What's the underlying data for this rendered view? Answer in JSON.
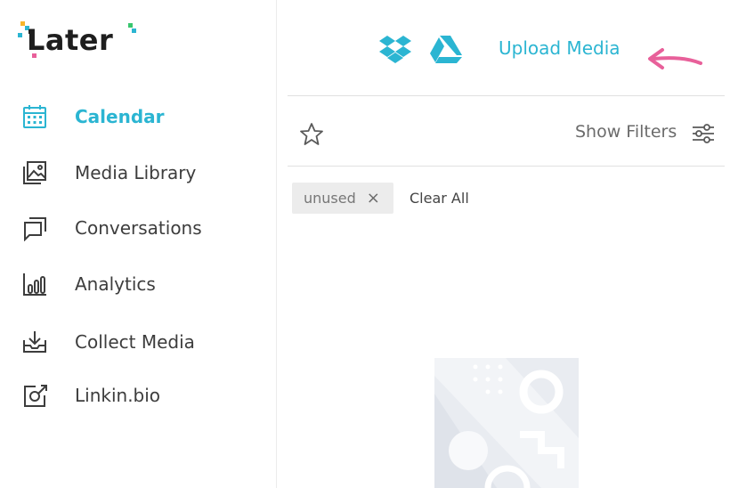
{
  "brand": {
    "logo_text": "Later",
    "colors": {
      "accent": "#2bb5d2",
      "arrow": "#e8609a",
      "text": "#3d3d3d"
    }
  },
  "sidebar": {
    "items": [
      {
        "label": "Calendar",
        "icon": "calendar-icon",
        "active": true
      },
      {
        "label": "Media Library",
        "icon": "media-library-icon",
        "active": false
      },
      {
        "label": "Conversations",
        "icon": "conversations-icon",
        "active": false
      },
      {
        "label": "Analytics",
        "icon": "analytics-icon",
        "active": false
      },
      {
        "label": "Collect Media",
        "icon": "collect-media-icon",
        "active": false
      },
      {
        "label": "Linkin.bio",
        "icon": "linkin-bio-icon",
        "active": false
      }
    ]
  },
  "topbar": {
    "sources": [
      {
        "name": "dropbox-icon"
      },
      {
        "name": "google-drive-icon"
      }
    ],
    "upload_label": "Upload Media"
  },
  "filters": {
    "favorite_icon": "star-icon",
    "show_filters_label": "Show Filters",
    "filter_icon": "sliders-icon",
    "active_tags": [
      {
        "label": "unused",
        "remove_icon": "×"
      }
    ],
    "clear_all_label": "Clear All"
  },
  "empty_state": {
    "illustration": "empty-media-illustration"
  }
}
